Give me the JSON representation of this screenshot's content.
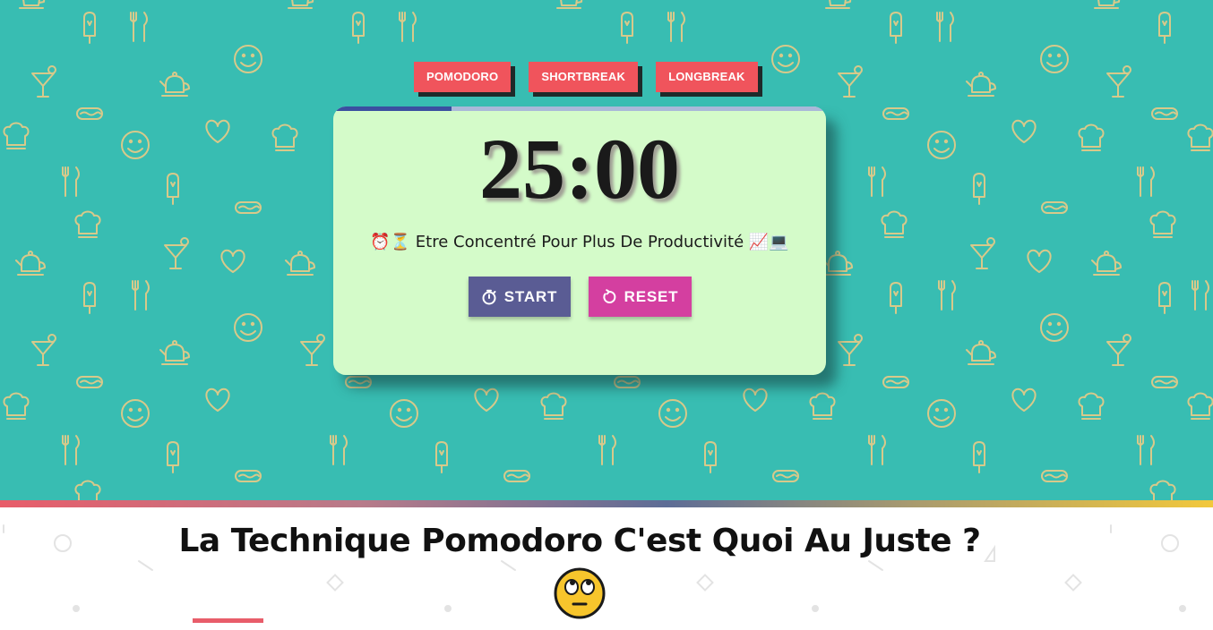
{
  "modes": {
    "pomodoro_label": "POMODORO",
    "shortbreak_label": "SHORTBREAK",
    "longbreak_label": "LONGBREAK"
  },
  "timer": {
    "time": "25:00",
    "progress_percent": 24,
    "focus_message": "⏰⏳ Etre Concentré Pour Plus De Productivité 📈💻"
  },
  "controls": {
    "start_label": "START",
    "reset_label": "RESET"
  },
  "section": {
    "title": "La Technique Pomodoro C'est Quoi Au Juste ?"
  },
  "colors": {
    "hero_background": "#38bdb2",
    "pattern": "#d8c98a",
    "mode_button": "#f0545c",
    "card": "#d4fbc9",
    "start_button": "#5a5c94",
    "reset_button": "#d43fa0",
    "accent_red": "#e85d6a",
    "accent_yellow": "#f2c83c"
  },
  "icons": {
    "start": "stopwatch-icon",
    "reset": "refresh-icon",
    "title_emoji": "rolling-eyes-face-icon"
  }
}
